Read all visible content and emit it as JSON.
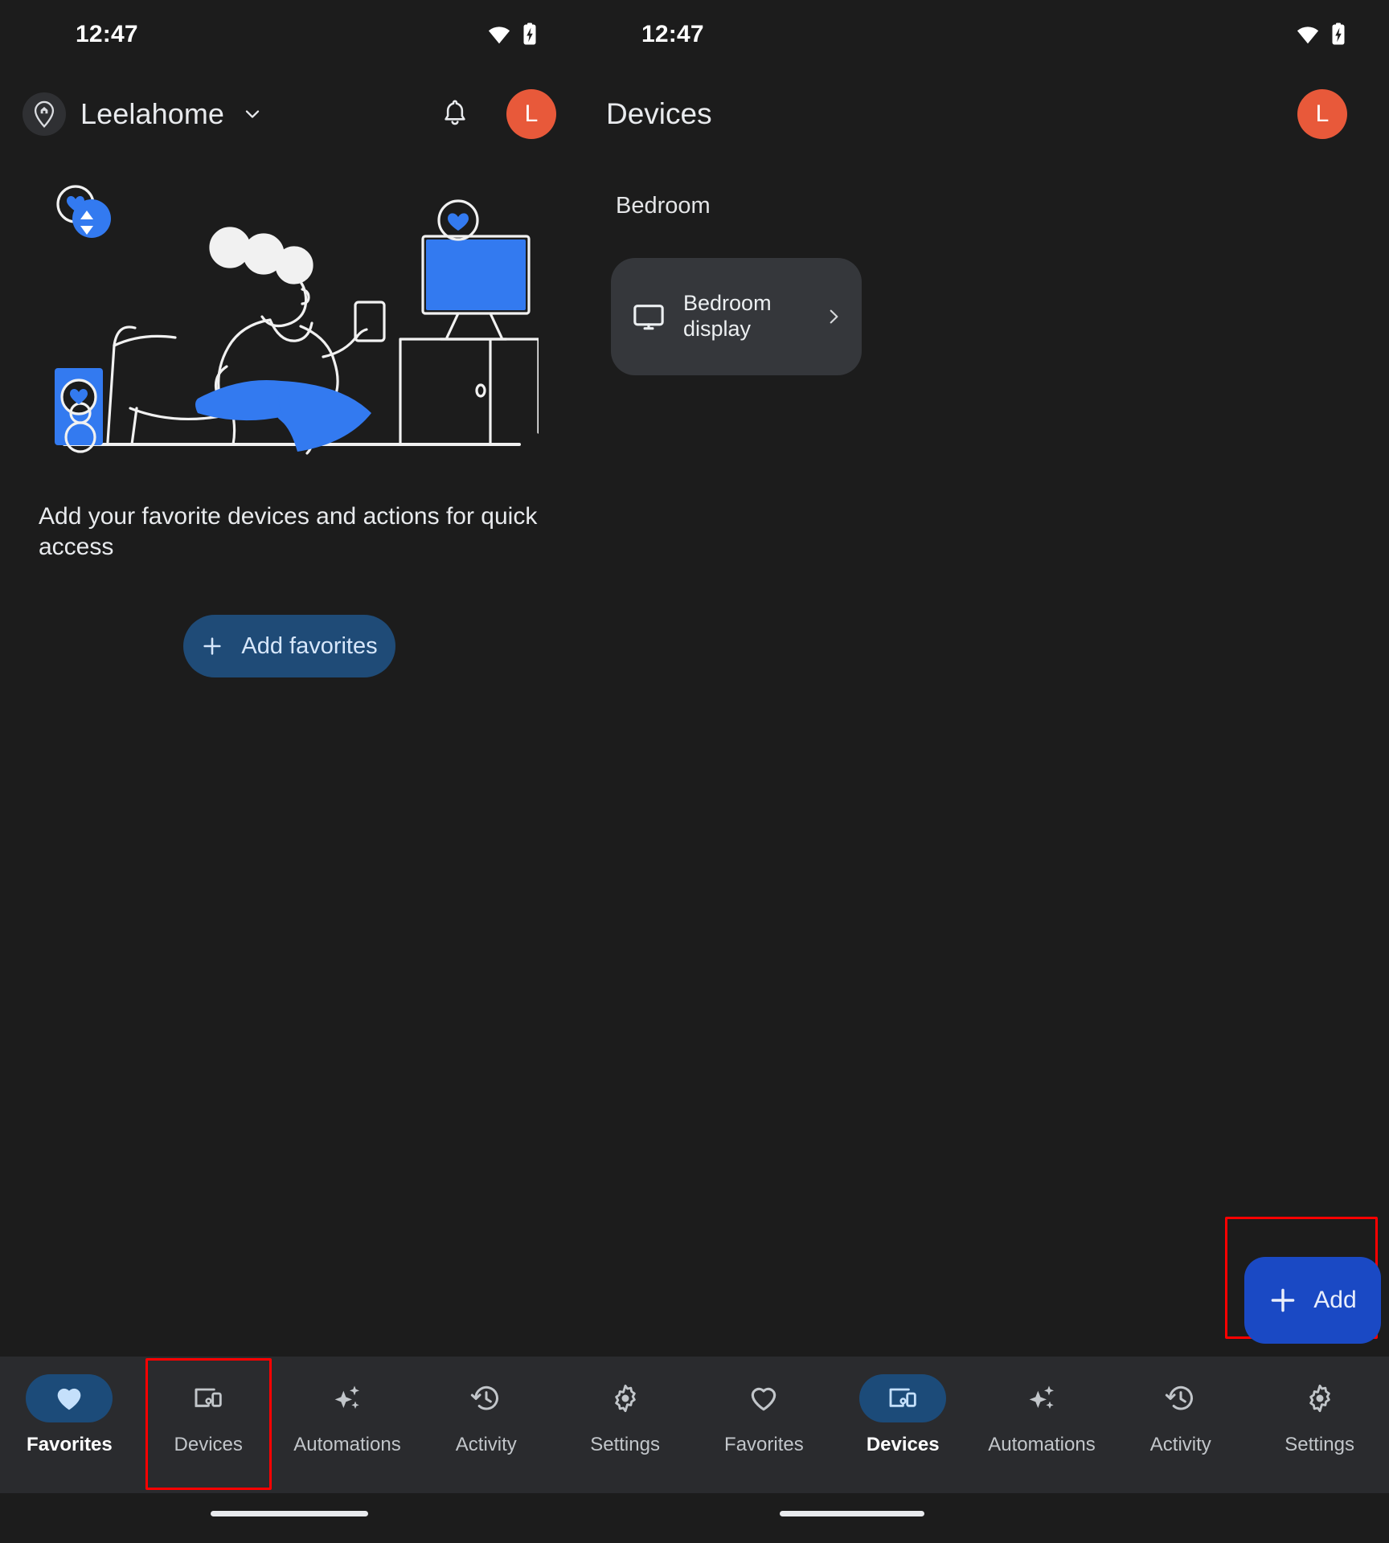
{
  "status_bar": {
    "clock_left": "12:47",
    "clock_right": "12:47",
    "wifi_icon": "wifi-icon",
    "battery_icon": "battery-charging-icon"
  },
  "left_pane": {
    "app_bar": {
      "home_icon": "home-pin-icon",
      "home_name": "Leelahome",
      "chevron_icon": "chevron-down-icon",
      "bell_icon": "notification-bell-icon",
      "avatar_initial": "L"
    },
    "illustration": "person-on-chair-with-phone-tv-speaker-illustration",
    "empty_state_text": "Add your favorite devices and actions for quick access",
    "add_favorites_button": {
      "label": "Add favorites",
      "plus_icon": "plus-icon"
    }
  },
  "right_pane": {
    "app_bar": {
      "title": "Devices",
      "avatar_initial": "L"
    },
    "room_heading": "Bedroom",
    "devices": [
      {
        "name": "Bedroom display",
        "icon": "display-icon",
        "chevron": "chevron-right-icon"
      }
    ],
    "fab": {
      "label": "Add",
      "plus_icon": "plus-icon"
    }
  },
  "bottom_nav": {
    "left": [
      {
        "label": "Favorites",
        "icon": "heart-filled-icon",
        "active": true
      },
      {
        "label": "Devices",
        "icon": "devices-icon",
        "active": false
      },
      {
        "label": "Automations",
        "icon": "sparkles-icon",
        "active": false
      },
      {
        "label": "Activity",
        "icon": "history-clock-icon",
        "active": false
      },
      {
        "label": "Settings",
        "icon": "gear-icon",
        "active": false
      }
    ],
    "right": [
      {
        "label": "Favorites",
        "icon": "heart-outline-icon",
        "active": false
      },
      {
        "label": "Devices",
        "icon": "devices-icon",
        "active": true
      },
      {
        "label": "Automations",
        "icon": "sparkles-icon",
        "active": false
      },
      {
        "label": "Activity",
        "icon": "history-clock-icon",
        "active": false
      },
      {
        "label": "Settings",
        "icon": "gear-icon",
        "active": false
      }
    ]
  },
  "colors": {
    "background": "#1c1c1c",
    "nav_background": "#2a2b2e",
    "card_background": "#35373b",
    "accent_blue": "#1a49c4",
    "pill_blue": "#1c4b79",
    "avatar_orange": "#e8593a",
    "highlight_red": "#ff0000",
    "illustration_blue": "#337af0"
  }
}
